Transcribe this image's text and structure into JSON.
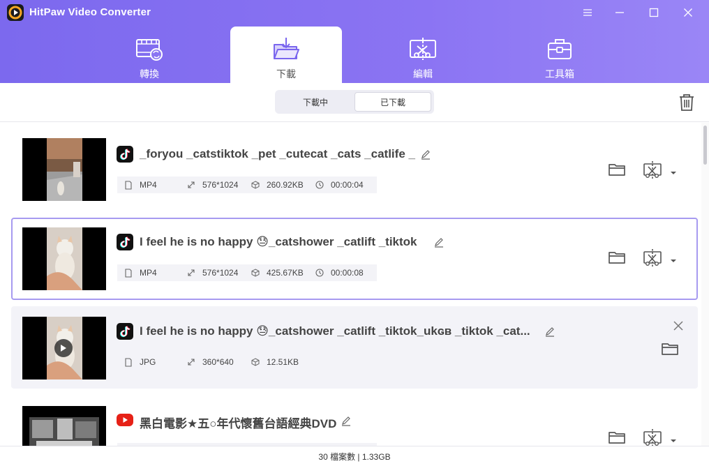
{
  "app": {
    "title": "HitPaw Video Converter",
    "accent": "#8672f2",
    "logo_icon": "hitpaw-logo-icon"
  },
  "window_controls": [
    {
      "name": "menu-icon"
    },
    {
      "name": "minimize-icon"
    },
    {
      "name": "maximize-icon"
    },
    {
      "name": "close-icon"
    }
  ],
  "tabs": [
    {
      "label": "轉換",
      "icon": "convert-film-icon",
      "active": false
    },
    {
      "label": "下載",
      "icon": "download-folder-icon",
      "active": true
    },
    {
      "label": "編輯",
      "icon": "edit-cut-icon",
      "active": false
    },
    {
      "label": "工具箱",
      "icon": "toolbox-icon",
      "active": false
    }
  ],
  "segment": {
    "downloading": "下載中",
    "downloaded": "已下載",
    "active": "downloaded"
  },
  "items": [
    {
      "source": "tiktok",
      "title": "_foryou _catstiktok _pet _cutecat _cats _catlife _",
      "format": "MP4",
      "resolution": "576*1024",
      "size": "260.92KB",
      "duration": "00:00:04"
    },
    {
      "source": "tiktok",
      "title": "I feel he is no happy 😓_catshower _catlift _tiktok",
      "format": "MP4",
      "resolution": "576*1024",
      "size": "425.67KB",
      "duration": "00:00:08"
    },
    {
      "source": "tiktok",
      "title": "I feel he is no happy 😓_catshower _catlift _tiktok_ukɢʙ _tiktok _cat...",
      "format": "JPG",
      "resolution": "360*640",
      "size": "12.51KB"
    },
    {
      "source": "youtube",
      "title": "黑白電影★五○年代懷舊台語經典DVD"
    }
  ],
  "status": {
    "text": "30 檔案數 | 1.33GB"
  }
}
